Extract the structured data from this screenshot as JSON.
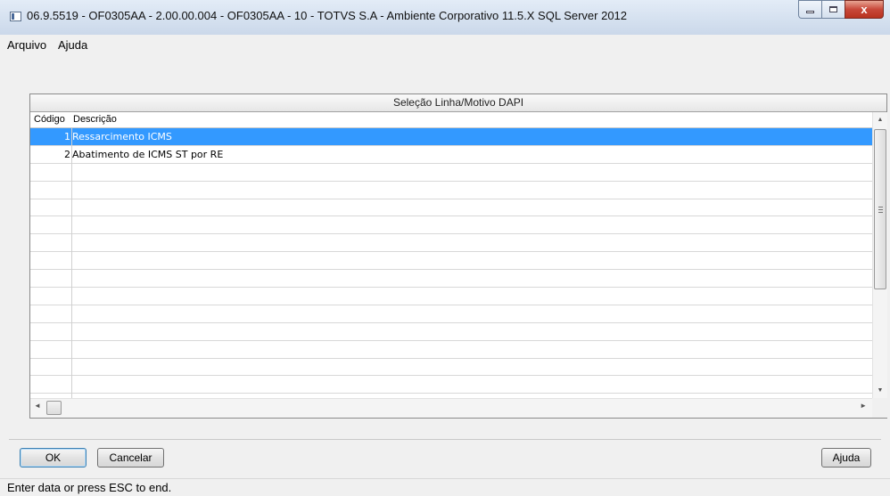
{
  "window": {
    "title": "06.9.5519 - OF0305AA - 2.00.00.004 - OF0305AA - 10 - TOTVS S.A - Ambiente Corporativo 11.5.X SQL Server 2012",
    "min_glyph": "",
    "max_glyph": "",
    "close_glyph": "x"
  },
  "menu": {
    "items": [
      "Arquivo",
      "Ajuda"
    ]
  },
  "browse": {
    "title": "Seleção Linha/Motivo DAPI",
    "columns": {
      "code": "Código",
      "description": "Descrição"
    },
    "rows": [
      {
        "code": "1",
        "description": "Ressarcimento ICMS",
        "selected": true
      },
      {
        "code": "2",
        "description": "Abatimento de ICMS ST por RE",
        "selected": false
      },
      {
        "code": "",
        "description": ""
      },
      {
        "code": "",
        "description": ""
      },
      {
        "code": "",
        "description": ""
      },
      {
        "code": "",
        "description": ""
      },
      {
        "code": "",
        "description": ""
      },
      {
        "code": "",
        "description": ""
      },
      {
        "code": "",
        "description": ""
      },
      {
        "code": "",
        "description": ""
      },
      {
        "code": "",
        "description": ""
      },
      {
        "code": "",
        "description": ""
      },
      {
        "code": "",
        "description": ""
      },
      {
        "code": "",
        "description": ""
      },
      {
        "code": "",
        "description": ""
      }
    ],
    "scroll_up": "▲",
    "scroll_down": "▼",
    "scroll_left": "◄",
    "scroll_right": "►"
  },
  "buttons": {
    "ok": "OK",
    "cancel": "Cancelar",
    "help": "Ajuda"
  },
  "status": {
    "text": "Enter data or press ESC to end."
  },
  "colors": {
    "selection": "#3399ff",
    "title_bar": "#d4e0ef",
    "close_button": "#c8483a"
  }
}
